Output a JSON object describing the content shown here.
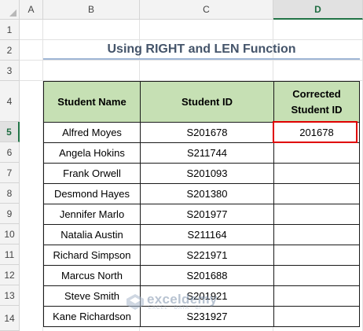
{
  "columns": [
    "A",
    "B",
    "C",
    "D"
  ],
  "rows": [
    "1",
    "2",
    "3",
    "4",
    "5",
    "6",
    "7",
    "8",
    "9",
    "10",
    "11",
    "12",
    "13",
    "14"
  ],
  "title": "Using RIGHT and LEN Function",
  "table": {
    "headers": [
      "Student Name",
      "Student ID",
      "Corrected Student ID"
    ],
    "rows": [
      {
        "name": "Alfred Moyes",
        "id": "S201678",
        "corrected": "201678"
      },
      {
        "name": "Angela Hokins",
        "id": "S211744",
        "corrected": ""
      },
      {
        "name": "Frank Orwell",
        "id": "S201093",
        "corrected": ""
      },
      {
        "name": "Desmond Hayes",
        "id": "S201380",
        "corrected": ""
      },
      {
        "name": "Jennifer Marlo",
        "id": "S201977",
        "corrected": ""
      },
      {
        "name": "Natalia Austin",
        "id": "S211164",
        "corrected": ""
      },
      {
        "name": "Richard Simpson",
        "id": "S221971",
        "corrected": ""
      },
      {
        "name": "Marcus North",
        "id": "S201688",
        "corrected": ""
      },
      {
        "name": "Steve Smith",
        "id": "S201921",
        "corrected": ""
      },
      {
        "name": "Kane Richardson",
        "id": "S231927",
        "corrected": ""
      }
    ]
  },
  "selected_cell": "D5",
  "watermark": {
    "name": "exceldemy",
    "tagline": "EXCEL · DATA · BI"
  },
  "colors": {
    "header_fill": "#c6e0b4",
    "selection_border": "#e00000",
    "title_text": "#44546a"
  }
}
